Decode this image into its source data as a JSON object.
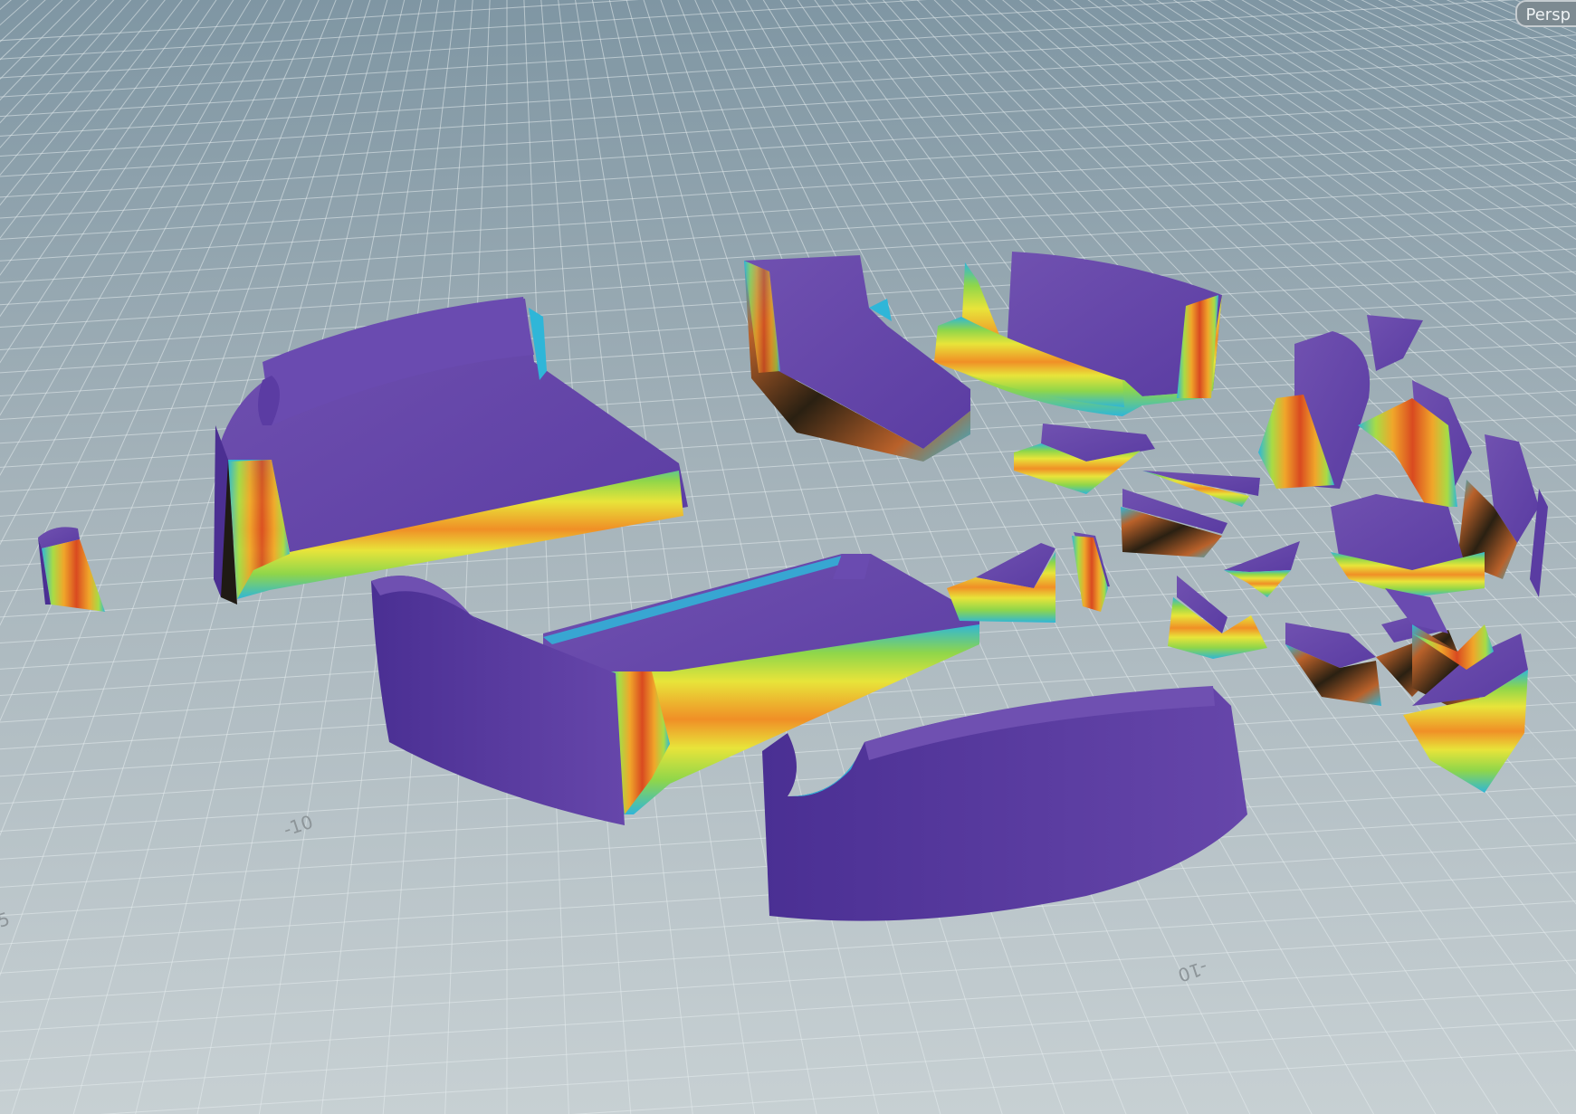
{
  "viewport": {
    "camera_label": "Persp",
    "grid_labels": [
      "-10",
      "5",
      "-10"
    ],
    "colors": {
      "sky_top": "#7f96a3",
      "sky_bottom": "#c3ccd0",
      "grid_line": "#e6ecee",
      "piece_top": "#6545a6",
      "piece_side": "#5637a0",
      "heat_cool": "#35b8d6",
      "heat_mid": "#e8e43a",
      "heat_warm": "#f09225",
      "heat_hot": "#d94a20"
    }
  }
}
